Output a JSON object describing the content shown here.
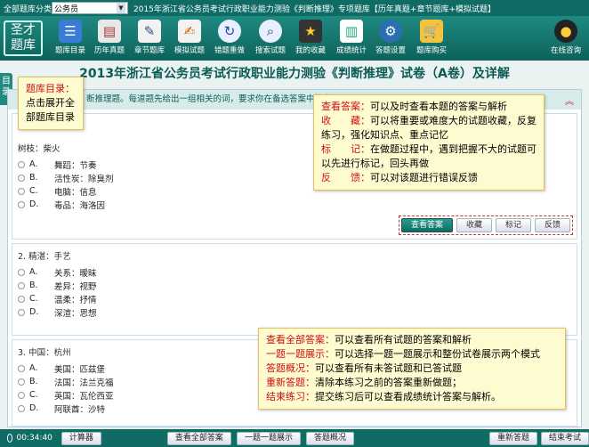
{
  "topbar": {
    "category_label": "全部题库分类",
    "category_value": "公务员",
    "title": "2015年浙江省公务员考试行政职业能力测验《判断推理》专项题库【历年真题+章节题库+模拟试题】"
  },
  "logo": {
    "text": "圣才题库"
  },
  "toolbar": {
    "items": [
      {
        "label": "题库目录",
        "icon": "catalog-icon"
      },
      {
        "label": "历年真题",
        "icon": "papers-icon"
      },
      {
        "label": "章节题库",
        "icon": "chapter-book-icon"
      },
      {
        "label": "模拟试题",
        "icon": "mock-test-icon"
      },
      {
        "label": "错题重做",
        "icon": "redo-icon"
      },
      {
        "label": "搜索试题",
        "icon": "search-icon"
      },
      {
        "label": "我的收藏",
        "icon": "bookmark-icon"
      },
      {
        "label": "成绩统计",
        "icon": "stats-icon"
      },
      {
        "label": "答题设置",
        "icon": "gear-icon"
      },
      {
        "label": "题库购买",
        "icon": "cart-icon"
      }
    ],
    "online_service": "在线咨询"
  },
  "exam_title": "2013年浙江省公务员考试行政职业能力测验《判断推理》试卷（A卷）及详解",
  "left_tab": "目录",
  "instructions": "断推理题。每道题先给出一组相关的词，要求你在备选答案中找出",
  "questions": [
    {
      "title": "1.",
      "stem": "树枝：柴火",
      "options": [
        {
          "letter": "A.",
          "text": "舞蹈：节奏"
        },
        {
          "letter": "B.",
          "text": "活性炭：除臭剂"
        },
        {
          "letter": "C.",
          "text": "电脑：信息"
        },
        {
          "letter": "D.",
          "text": "毒品：海洛因"
        }
      ]
    },
    {
      "title": "2. 精湛：手艺",
      "options": [
        {
          "letter": "A.",
          "text": "关系：暧昧"
        },
        {
          "letter": "B.",
          "text": "差异：视野"
        },
        {
          "letter": "C.",
          "text": "温柔：抒情"
        },
        {
          "letter": "D.",
          "text": "深渲：思想"
        }
      ]
    },
    {
      "title": "3. 中国：杭州",
      "options": [
        {
          "letter": "A.",
          "text": "美国：匹兹堡"
        },
        {
          "letter": "B.",
          "text": "法国：法兰克福"
        },
        {
          "letter": "C.",
          "text": "英国：瓦伦西亚"
        },
        {
          "letter": "D.",
          "text": "阿联酋：沙特"
        }
      ]
    }
  ],
  "question_buttons": {
    "view": "查看答案",
    "fav": "收藏",
    "mark": "标记",
    "feedback": "反馈"
  },
  "tooltip_catalog": {
    "head": "题库目录：",
    "body": "点击展开全部题库目录"
  },
  "tooltip_question": [
    {
      "k": "查看答案：",
      "v": "可以及时查看本题的答案与解析"
    },
    {
      "k": "收　　藏：",
      "v": "可以将重要或难度大的试题收藏，反复练习，强化知识点、重点记忆"
    },
    {
      "k": "标　　记：",
      "v": "在做题过程中，遇到把握不大的试题可以先进行标记，回头再做"
    },
    {
      "k": "反　　馈：",
      "v": "可以对该题进行错误反馈"
    }
  ],
  "tooltip_bottom": [
    {
      "k": "查看全部答案：",
      "v": "可以查看所有试题的答案和解析"
    },
    {
      "k": "一题一题展示：",
      "v": "可以选择一题一题展示和整份试卷展示两个模式"
    },
    {
      "k": "答题概况：",
      "v": "可以查看所有未答试题和已答试题"
    },
    {
      "k": "重新答题：",
      "v": "清除本练习之前的答案重新做题；"
    },
    {
      "k": "结束练习：",
      "v": "提交练习后可以查看成绩统计答案与解析。"
    }
  ],
  "bottombar": {
    "timer": "00:34:40",
    "calculator": "计算器",
    "view_all": "查看全部答案",
    "one_by_one": "一题一题展示",
    "overview": "答题概况",
    "restart": "重新答题",
    "finish": "结束考试"
  },
  "colors": {
    "primary": "#0f6b64",
    "accent_red": "#cc3333",
    "tooltip_bg": "#fffbd0"
  }
}
